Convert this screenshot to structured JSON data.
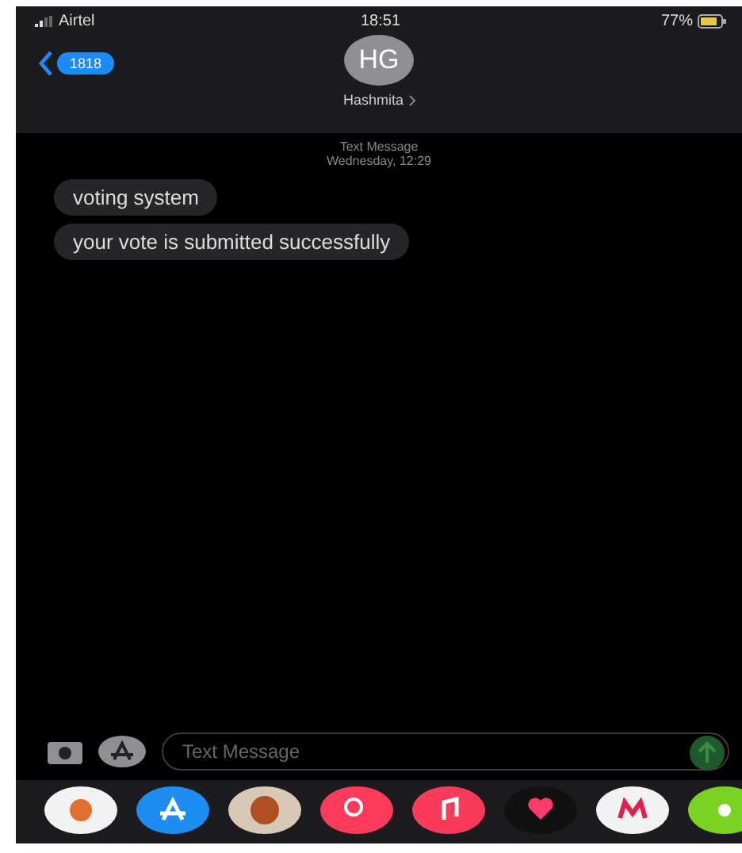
{
  "status_bar": {
    "carrier": "Airtel",
    "time": "18:51",
    "battery": "77%"
  },
  "header": {
    "back_badge": "1818",
    "avatar_initials": "HG",
    "contact_name": "Hashmita"
  },
  "thread": {
    "service": "Text Message",
    "timestamp": "Wednesday, 12:29"
  },
  "messages": [
    {
      "text": "voting system"
    },
    {
      "text": "your vote is submitted successfully"
    }
  ],
  "composer": {
    "placeholder": "Text Message"
  },
  "app_drawer": [
    {
      "kind": "photos"
    },
    {
      "kind": "appstore"
    },
    {
      "kind": "memoji"
    },
    {
      "kind": "search"
    },
    {
      "kind": "music"
    },
    {
      "kind": "heart"
    },
    {
      "kind": "letter"
    },
    {
      "kind": "dot"
    }
  ]
}
